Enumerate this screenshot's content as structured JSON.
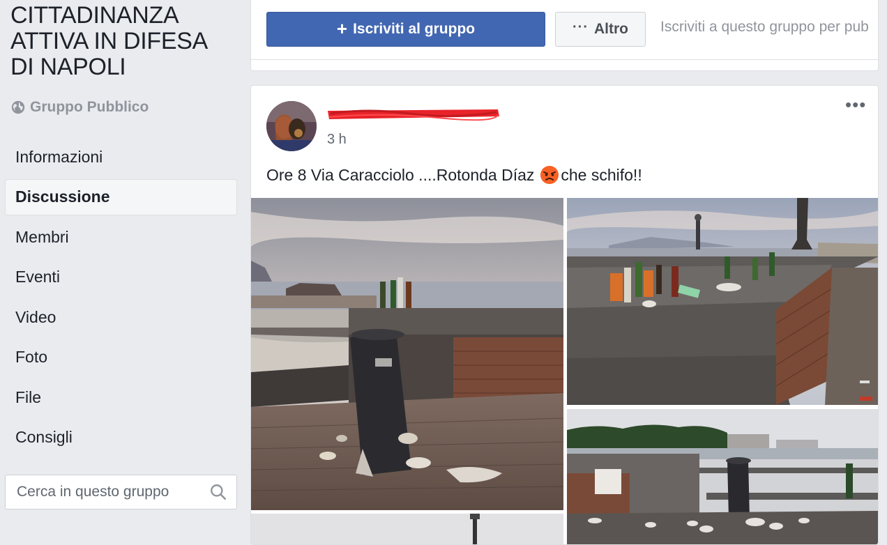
{
  "group": {
    "title": "CITTADINANZA ATTIVA IN DIFESA DI NAPOLI",
    "type_label": "Gruppo Pubblico",
    "type_icon": "globe-icon"
  },
  "nav": {
    "items": [
      {
        "label": "Informazioni",
        "active": false
      },
      {
        "label": "Discussione",
        "active": true
      },
      {
        "label": "Membri",
        "active": false
      },
      {
        "label": "Eventi",
        "active": false
      },
      {
        "label": "Video",
        "active": false
      },
      {
        "label": "Foto",
        "active": false
      },
      {
        "label": "File",
        "active": false
      },
      {
        "label": "Consigli",
        "active": false
      }
    ]
  },
  "search": {
    "placeholder": "Cerca in questo gruppo",
    "icon": "search-icon"
  },
  "header": {
    "join_label": "Iscriviti al gruppo",
    "more_label": "Altro",
    "join_hint": "Iscriviti a questo gruppo per pub"
  },
  "post": {
    "time": "3 h",
    "text_before": "Ore 8 Via Caracciolo ....Rotonda Díaz",
    "emoji": "angry-face-emoji",
    "text_after": "che schifo!!",
    "menu_icon": "more-dots-icon"
  },
  "colors": {
    "primary": "#4267b2",
    "background": "#e9ebee",
    "secondary_text": "#90949c",
    "redaction": "#e8232a"
  }
}
